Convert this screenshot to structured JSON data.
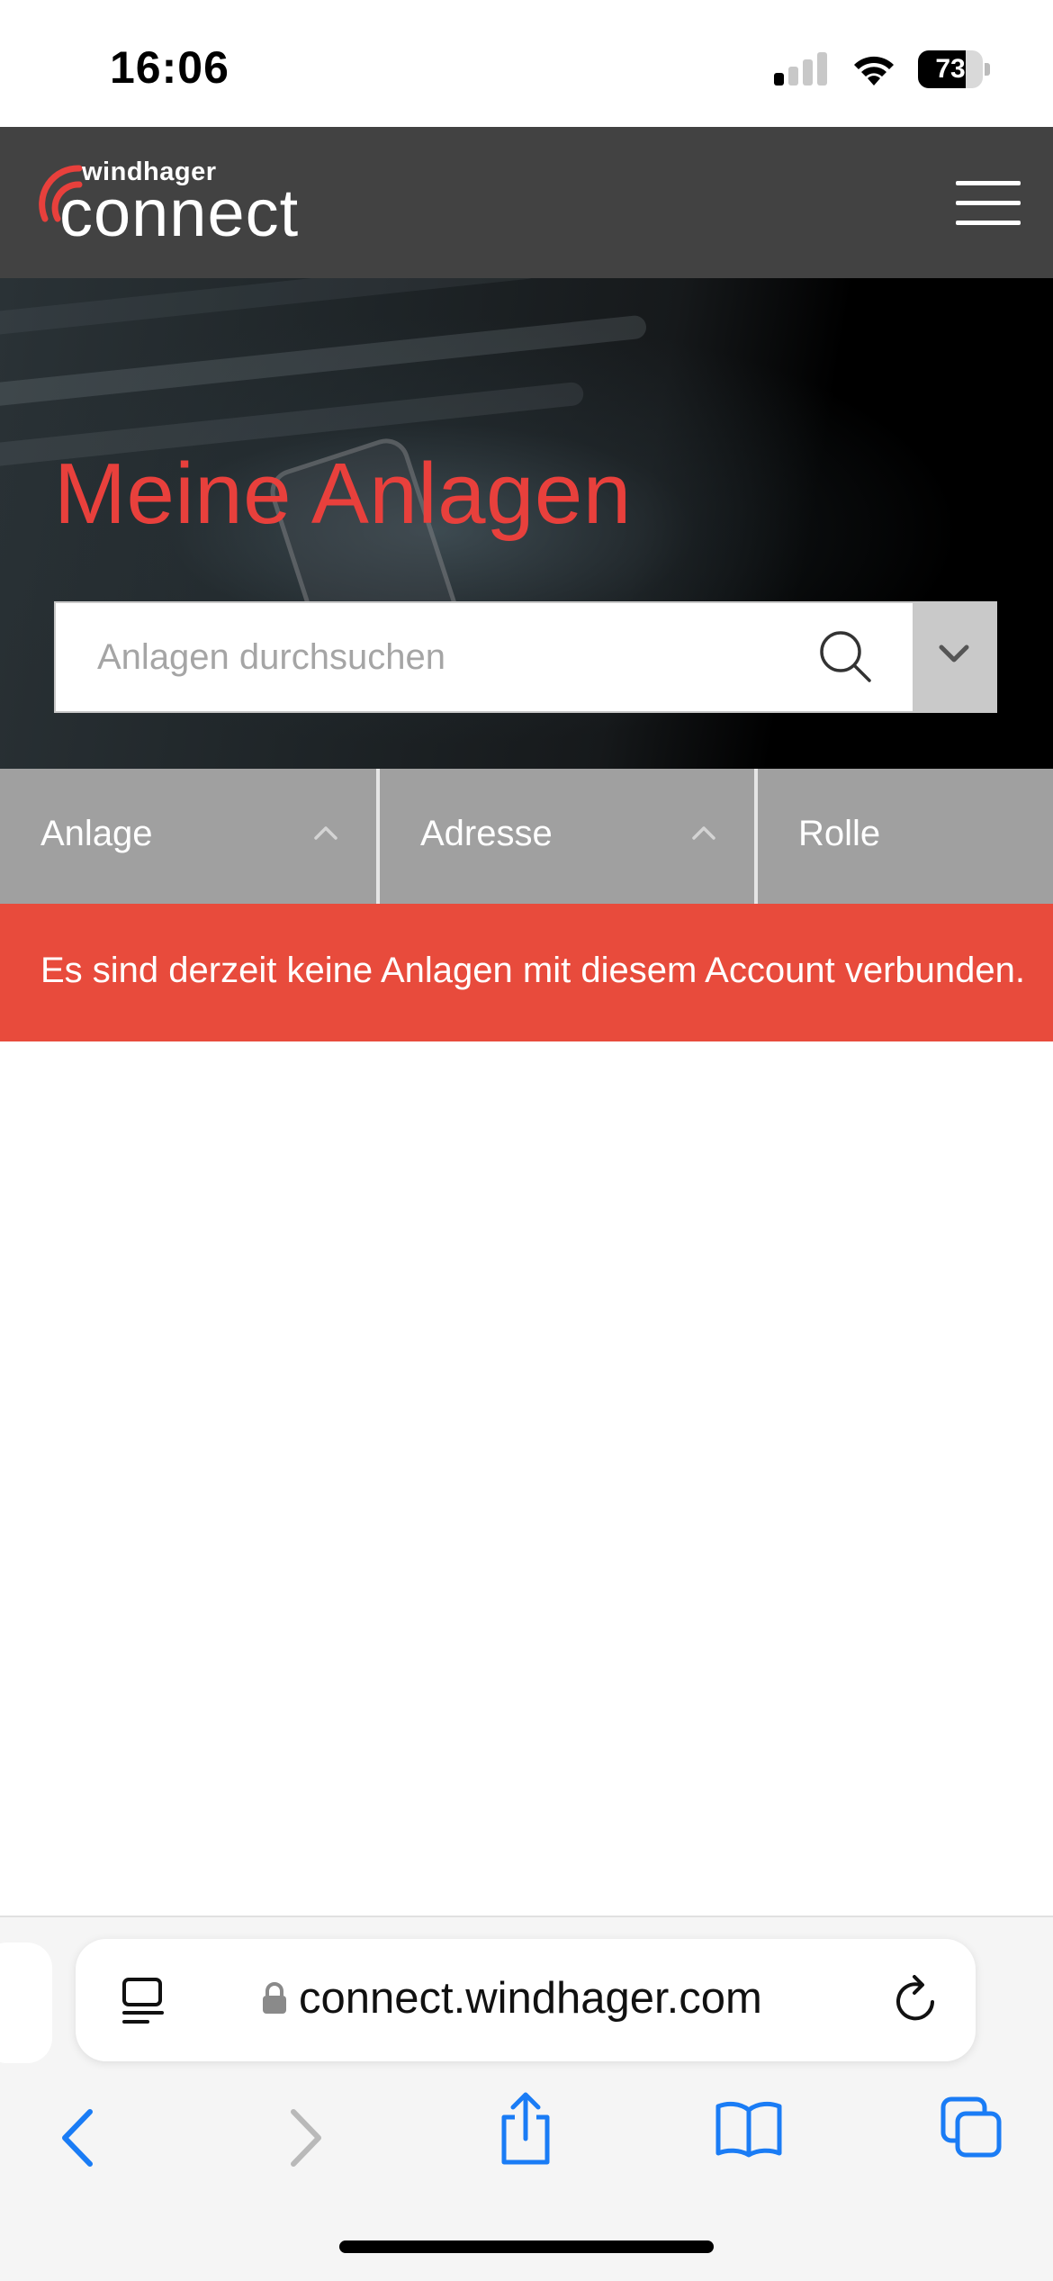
{
  "status_bar": {
    "time": "16:06",
    "battery_level": "73",
    "battery_fraction": 0.73,
    "icons": [
      "cellular-signal-icon",
      "wifi-icon",
      "battery-icon"
    ]
  },
  "header": {
    "logo_small": "windhager",
    "logo_big": "connect",
    "menu_icon": "hamburger-menu-icon"
  },
  "hero": {
    "title": "Meine Anlagen",
    "search": {
      "placeholder": "Anlagen durchsuchen",
      "value": ""
    }
  },
  "table": {
    "columns": [
      {
        "label": "Anlage",
        "sortable": true
      },
      {
        "label": "Adresse",
        "sortable": true
      },
      {
        "label": "Rolle",
        "sortable": false
      }
    ],
    "empty_message": "Es sind derzeit keine Anlagen mit diesem Account verbunden."
  },
  "browser": {
    "url": "connect.windhager.com",
    "nav": [
      "back-icon",
      "forward-icon",
      "share-icon",
      "bookmarks-icon",
      "tabs-icon"
    ]
  },
  "colors": {
    "accent_red": "#e8403c",
    "notice_red": "#e84b3c",
    "header_bg": "#424242",
    "table_header_bg": "#a0a0a0",
    "ios_blue": "#1a7cf5"
  }
}
